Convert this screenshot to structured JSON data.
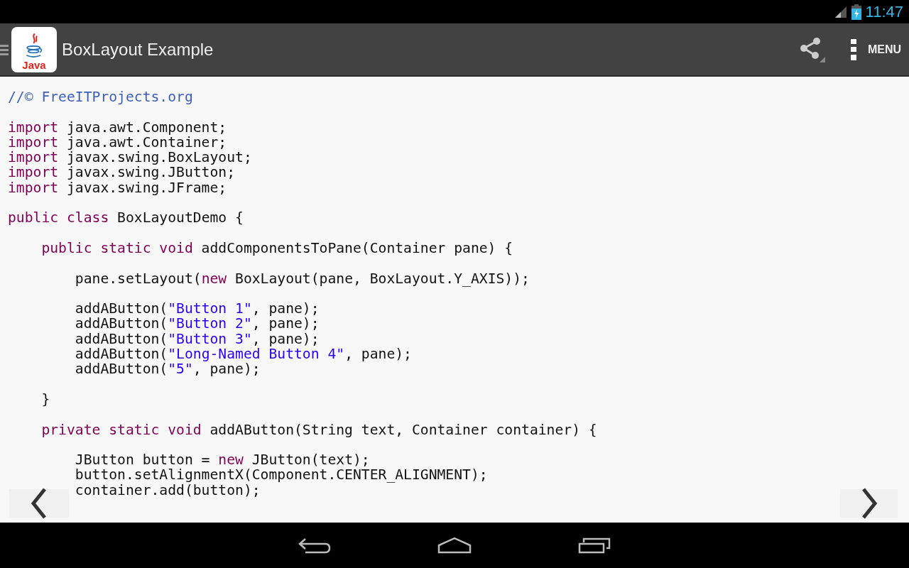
{
  "status_bar": {
    "time": "11:47"
  },
  "action_bar": {
    "logo_text": "Java",
    "title": "BoxLayout Example",
    "menu_label": "MENU"
  },
  "code_lines": [
    {
      "kind": "code",
      "tokens": [
        {
          "kind": "comment",
          "text": "//© FreeITProjects.org"
        }
      ]
    },
    {
      "kind": "blank"
    },
    {
      "kind": "code",
      "tokens": [
        {
          "kind": "keyword",
          "text": "import"
        },
        {
          "kind": "plain",
          "text": " java.awt.Component;"
        }
      ]
    },
    {
      "kind": "code",
      "tokens": [
        {
          "kind": "keyword",
          "text": "import"
        },
        {
          "kind": "plain",
          "text": " java.awt.Container;"
        }
      ]
    },
    {
      "kind": "code",
      "tokens": [
        {
          "kind": "keyword",
          "text": "import"
        },
        {
          "kind": "plain",
          "text": " javax.swing.BoxLayout;"
        }
      ]
    },
    {
      "kind": "code",
      "tokens": [
        {
          "kind": "keyword",
          "text": "import"
        },
        {
          "kind": "plain",
          "text": " javax.swing.JButton;"
        }
      ]
    },
    {
      "kind": "code",
      "tokens": [
        {
          "kind": "keyword",
          "text": "import"
        },
        {
          "kind": "plain",
          "text": " javax.swing.JFrame;"
        }
      ]
    },
    {
      "kind": "blank"
    },
    {
      "kind": "code",
      "tokens": [
        {
          "kind": "keyword",
          "text": "public class"
        },
        {
          "kind": "plain",
          "text": " BoxLayoutDemo {"
        }
      ]
    },
    {
      "kind": "blank"
    },
    {
      "kind": "code",
      "tokens": [
        {
          "kind": "keyword",
          "text": "    public static void"
        },
        {
          "kind": "plain",
          "text": " addComponentsToPane(Container pane) {"
        }
      ]
    },
    {
      "kind": "blank"
    },
    {
      "kind": "code",
      "tokens": [
        {
          "kind": "plain",
          "text": "        pane.setLayout("
        },
        {
          "kind": "keyword",
          "text": "new"
        },
        {
          "kind": "plain",
          "text": " BoxLayout(pane, BoxLayout.Y_AXIS));"
        }
      ]
    },
    {
      "kind": "blank"
    },
    {
      "kind": "code",
      "tokens": [
        {
          "kind": "plain",
          "text": "        addAButton("
        },
        {
          "kind": "string",
          "text": "\"Button 1\""
        },
        {
          "kind": "plain",
          "text": ", pane);"
        }
      ]
    },
    {
      "kind": "code",
      "tokens": [
        {
          "kind": "plain",
          "text": "        addAButton("
        },
        {
          "kind": "string",
          "text": "\"Button 2\""
        },
        {
          "kind": "plain",
          "text": ", pane);"
        }
      ]
    },
    {
      "kind": "code",
      "tokens": [
        {
          "kind": "plain",
          "text": "        addAButton("
        },
        {
          "kind": "string",
          "text": "\"Button 3\""
        },
        {
          "kind": "plain",
          "text": ", pane);"
        }
      ]
    },
    {
      "kind": "code",
      "tokens": [
        {
          "kind": "plain",
          "text": "        addAButton("
        },
        {
          "kind": "string",
          "text": "\"Long-Named Button 4\""
        },
        {
          "kind": "plain",
          "text": ", pane);"
        }
      ]
    },
    {
      "kind": "code",
      "tokens": [
        {
          "kind": "plain",
          "text": "        addAButton("
        },
        {
          "kind": "string",
          "text": "\"5\""
        },
        {
          "kind": "plain",
          "text": ", pane);"
        }
      ]
    },
    {
      "kind": "blank"
    },
    {
      "kind": "code",
      "tokens": [
        {
          "kind": "plain",
          "text": "    }"
        }
      ]
    },
    {
      "kind": "blank"
    },
    {
      "kind": "code",
      "tokens": [
        {
          "kind": "keyword",
          "text": "    private static void"
        },
        {
          "kind": "plain",
          "text": " addAButton(String text, Container container) {"
        }
      ]
    },
    {
      "kind": "blank"
    },
    {
      "kind": "code",
      "tokens": [
        {
          "kind": "plain",
          "text": "        JButton button = "
        },
        {
          "kind": "keyword",
          "text": "new"
        },
        {
          "kind": "plain",
          "text": " JButton(text);"
        }
      ]
    },
    {
      "kind": "code",
      "tokens": [
        {
          "kind": "plain",
          "text": "        button.setAlignmentX(Component.CENTER_ALIGNMENT);"
        }
      ]
    },
    {
      "kind": "code",
      "tokens": [
        {
          "kind": "plain",
          "text": "        container.add(button);"
        }
      ]
    }
  ]
}
